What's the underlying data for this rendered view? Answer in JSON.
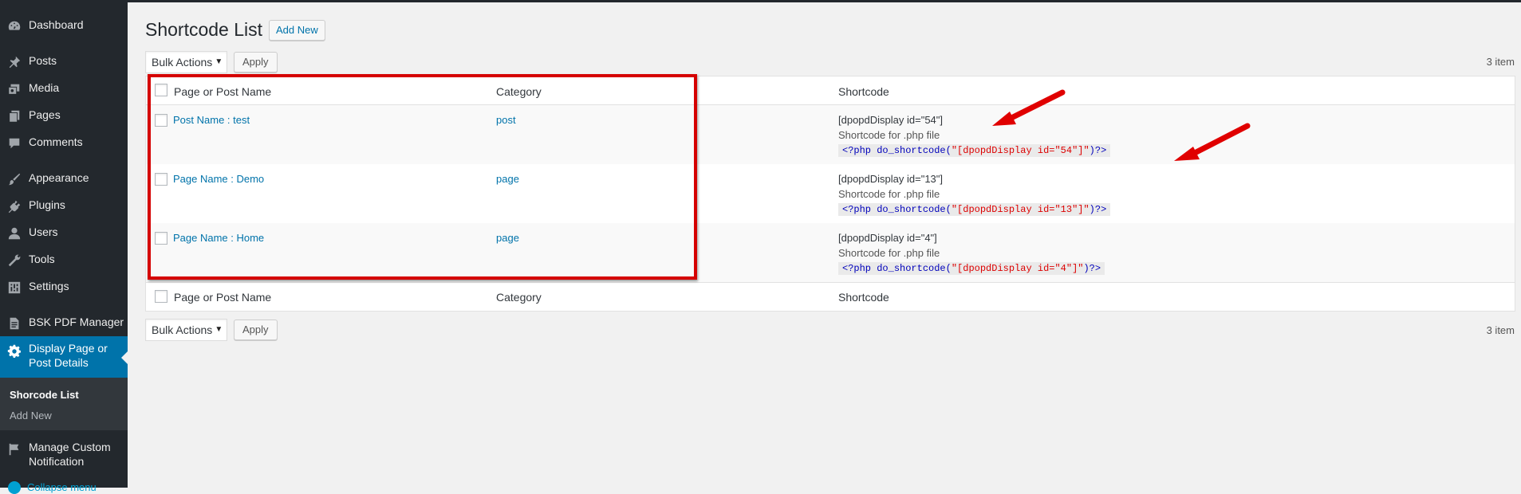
{
  "sidebar": {
    "items": [
      {
        "label": "Dashboard",
        "icon": "dashboard-icon"
      },
      {
        "label": "Posts",
        "icon": "pin-icon"
      },
      {
        "label": "Media",
        "icon": "media-icon"
      },
      {
        "label": "Pages",
        "icon": "pages-icon"
      },
      {
        "label": "Comments",
        "icon": "comment-icon"
      },
      {
        "label": "Appearance",
        "icon": "brush-icon"
      },
      {
        "label": "Plugins",
        "icon": "plug-icon"
      },
      {
        "label": "Users",
        "icon": "user-icon"
      },
      {
        "label": "Tools",
        "icon": "wrench-icon"
      },
      {
        "label": "Settings",
        "icon": "settings-icon"
      },
      {
        "label": "BSK PDF Manager",
        "icon": "document-icon"
      },
      {
        "label": "Display Page or Post Details",
        "icon": "gear-icon"
      },
      {
        "label": "Manage Custom Notification",
        "icon": "flag-icon"
      }
    ],
    "submenu": [
      "Shorcode List",
      "Add New"
    ],
    "collapse_label": "Collapse menu",
    "colors": {
      "bg": "#23282d",
      "current": "#0073aa"
    }
  },
  "header": {
    "title": "Shortcode List",
    "add_new": "Add New"
  },
  "toolbar_top": {
    "bulk_actions": "Bulk Actions",
    "apply": "Apply",
    "count": "3 item"
  },
  "toolbar_bottom": {
    "bulk_actions": "Bulk Actions",
    "apply": "Apply",
    "count": "3 item"
  },
  "table": {
    "columns": [
      "Page or Post Name",
      "Category",
      "Shortcode"
    ],
    "rows": [
      {
        "name": "Post Name : test",
        "category": "post",
        "shortcode": "[dpopdDisplay id=\"54\"]",
        "php_label": "Shortcode for .php file",
        "php_open": "<?php",
        "php_fn": "do_shortcode(",
        "php_str": "\"[dpopdDisplay id=\"54\"]\"",
        "php_close": ")?>"
      },
      {
        "name": "Page Name : Demo",
        "category": "page",
        "shortcode": "[dpopdDisplay id=\"13\"]",
        "php_label": "Shortcode for .php file",
        "php_open": "<?php",
        "php_fn": "do_shortcode(",
        "php_str": "\"[dpopdDisplay id=\"13\"]\"",
        "php_close": ")?>"
      },
      {
        "name": "Page Name : Home",
        "category": "page",
        "shortcode": "[dpopdDisplay id=\"4\"]",
        "php_label": "Shortcode for .php file",
        "php_open": "<?php",
        "php_fn": "do_shortcode(",
        "php_str": "\"[dpopdDisplay id=\"4\"]\"",
        "php_close": ")?>"
      }
    ]
  },
  "annotation_colors": {
    "box": "#d50000",
    "arrow": "#e00000"
  }
}
